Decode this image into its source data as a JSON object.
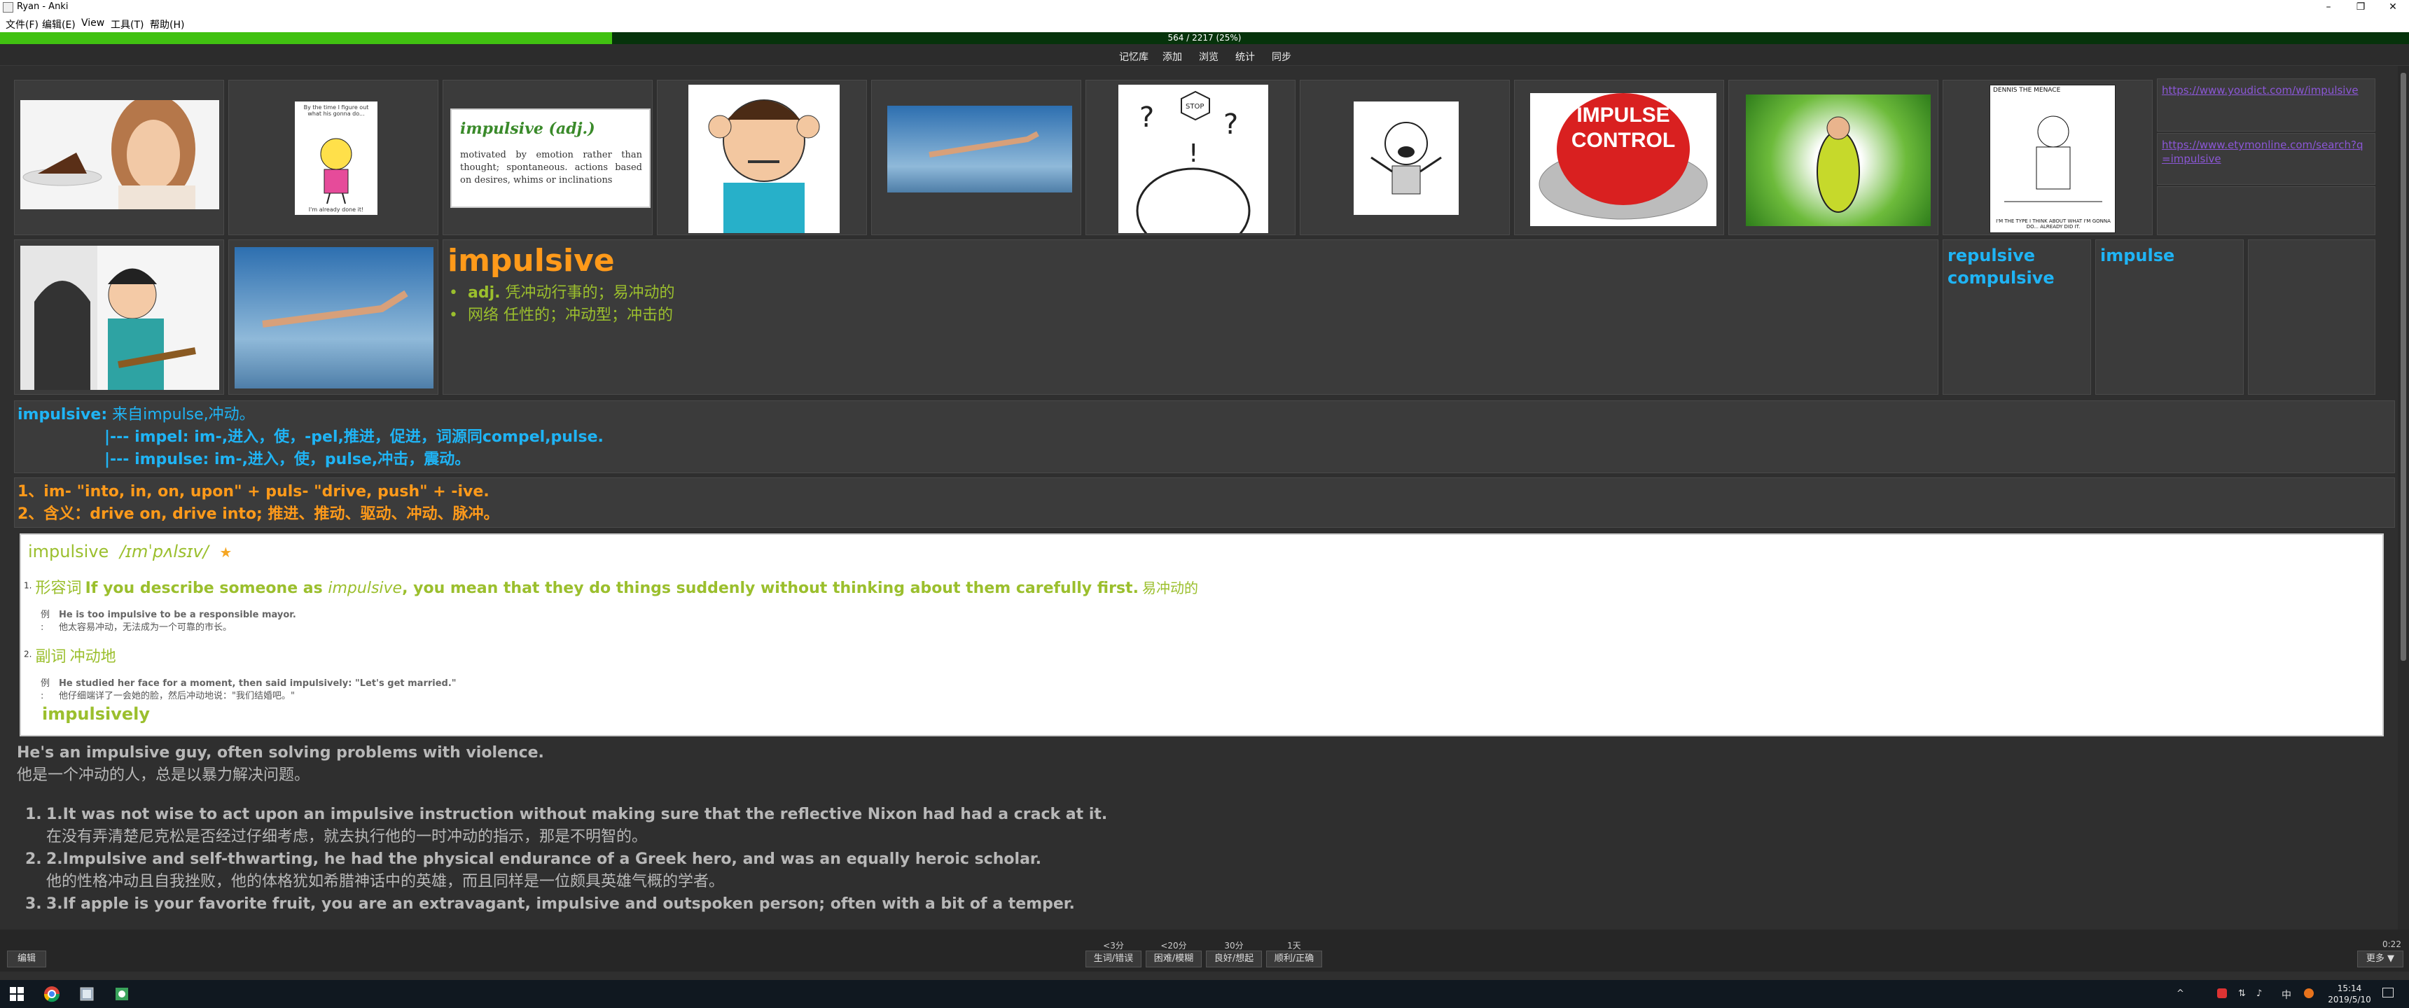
{
  "window": {
    "title": "Ryan - Anki",
    "minimize": "–",
    "maximize": "❐",
    "close": "✕"
  },
  "menu": [
    "文件(F)",
    "编辑(E)",
    "View",
    "工具(T)",
    "帮助(H)"
  ],
  "progress": {
    "text": "564 / 2217 (25%)",
    "fraction": 0.254
  },
  "toolbar": [
    "记忆库",
    "添加",
    "浏览",
    "统计",
    "同步"
  ],
  "images": {
    "definition_card": {
      "title": "impulsive (adj.)",
      "text": "motivated by emotion rather than thought; spontaneous. actions based on desires, whims or inclinations"
    },
    "button_text": "IMPULSE CONTROL",
    "comic_kid_text": "By the time I figure out what his gonna do...",
    "comic_kid_footer": "I'm already done it!",
    "dennis_title": "DENNIS THE MENACE",
    "dennis_caption": "I'M THE TYPE I THINK ABOUT WHAT I'M GONNA DO... ALREADY DID IT."
  },
  "links": [
    "https://www.youdict.com/w/impulsive",
    "https://www.etymonline.com/search?q=impulsive"
  ],
  "word": {
    "headword": "impulsive",
    "senses": [
      {
        "pos": "adj.",
        "text": "凭冲动行事的；易冲动的"
      },
      {
        "pos": "网络",
        "text": "任性的；冲动型；冲击的"
      }
    ],
    "related": [
      "repulsive",
      "compulsive"
    ],
    "root": "impulse"
  },
  "etymology": {
    "line1_word": "impulsive:",
    "line1_rest": " 来自impulse,冲动。",
    "line2": "|--- impel: im-,进入，使，-pel,推进，促进，词源同compel,pulse.",
    "line3": "|--- impulse: im-,进入，使，pulse,冲击，震动。"
  },
  "morphology": {
    "line1": "1、im- \"into, in, on, upon\" + puls- \"drive, push\" + -ive.",
    "line2": "2、含义：drive on, drive into; 推进、推动、驱动、冲动、脉冲。"
  },
  "dictionary": {
    "headword": "impulsive",
    "phonetic": "/ɪmˈpʌlsɪv/",
    "star": "★",
    "entries": [
      {
        "num": "1.",
        "pos": "形容词",
        "def_pre": "If you describe someone as ",
        "def_em": "impulsive",
        "def_post": ", you mean that they do things suddenly without thinking about them carefully first.",
        "cn": "易冲动的",
        "ex_label": "例",
        "ex_en": "He is too impulsive to be a responsible mayor.",
        "ex_cn": "他太容易冲动，无法成为一个可靠的市长。"
      },
      {
        "num": "2.",
        "pos": "副词",
        "def_pre": "",
        "def_em": "",
        "def_post": "",
        "cn": "冲动地",
        "ex_label": "例",
        "ex_en": "He studied her face for a moment, then said impulsively: \"Let's get married.\"",
        "ex_cn": "他仔细端详了一会她的脸，然后冲动地说：\"我们结婚吧。\""
      }
    ],
    "derived": "impulsively"
  },
  "examples": {
    "main_en": "He's an impulsive guy, often solving problems with violence.",
    "main_cn": "他是一个冲动的人，总是以暴力解决问题。",
    "list": [
      {
        "num": "1.",
        "en": "1.It was not wise to act upon an impulsive instruction without making sure that the reflective Nixon had had a crack at it.",
        "cn": "在没有弄清楚尼克松是否经过仔细考虑，就去执行他的一时冲动的指示，那是不明智的。"
      },
      {
        "num": "2.",
        "en": "2.Impulsive and self-thwarting, he had the physical endurance of a Greek hero, and was an equally heroic scholar.",
        "cn": "他的性格冲动且自我挫败，他的体格犹如希腊神话中的英雄，而且同样是一位颇具英雄气概的学者。"
      },
      {
        "num": "3.",
        "en": "3.If apple is your favorite fruit, you are an extravagant, impulsive and outspoken person; often with a bit of a temper.",
        "cn": ""
      }
    ]
  },
  "bottom": {
    "edit": "编辑",
    "answers": [
      {
        "time": "<3分",
        "label": "生词/错误"
      },
      {
        "time": "<20分",
        "label": "困难/模糊"
      },
      {
        "time": "30分",
        "label": "良好/想起"
      },
      {
        "time": "1天",
        "label": "顺利/正确"
      }
    ],
    "timer": "0:22",
    "more": "更多 ▼"
  },
  "taskbar": {
    "time": "15:14",
    "date": "2019/5/10",
    "ime": "中"
  },
  "colors": {
    "progress_fill": "#41c111",
    "blue": "#1fb4f5",
    "orange": "#ff9a1a",
    "olive": "#9bbf2d",
    "link": "#8b57d6"
  }
}
